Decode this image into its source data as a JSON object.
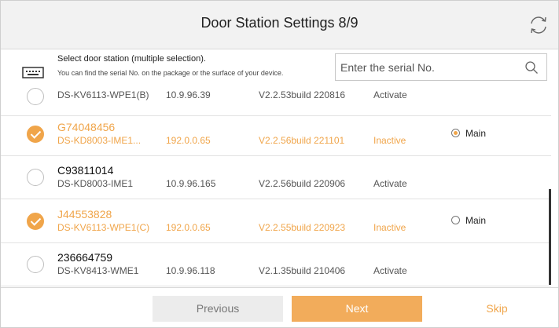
{
  "header": {
    "title": "Door Station Settings 8/9"
  },
  "hint": {
    "title": "Select door station (multiple selection).",
    "description": "You can find the serial No. on the package or the surface of your device."
  },
  "search": {
    "placeholder": "Enter the serial No.",
    "value": ""
  },
  "rows": [
    {
      "serial": "",
      "model": "DS-KV6113-WPE1(B)",
      "ip": "10.9.96.39",
      "version": "V2.2.53build 220816",
      "status": "Activate",
      "selected": false,
      "main": null
    },
    {
      "serial": "G74048456",
      "model": "DS-KD8003-IME1...",
      "ip": "192.0.0.65",
      "version": "V2.2.56build 221101",
      "status": "Inactive",
      "selected": true,
      "main": "Main"
    },
    {
      "serial": "C93811014",
      "model": "DS-KD8003-IME1",
      "ip": "10.9.96.165",
      "version": "V2.2.56build 220906",
      "status": "Activate",
      "selected": false,
      "main": null
    },
    {
      "serial": "J44553828",
      "model": "DS-KV6113-WPE1(C)",
      "ip": "192.0.0.65",
      "version": "V2.2.55build 220923",
      "status": "Inactive",
      "selected": true,
      "main": "Main"
    },
    {
      "serial": "236664759",
      "model": "DS-KV8413-WME1",
      "ip": "10.9.96.118",
      "version": "V2.1.35build 210406",
      "status": "Activate",
      "selected": false,
      "main": null
    }
  ],
  "footer": {
    "previous": "Previous",
    "next": "Next",
    "skip": "Skip"
  },
  "colors": {
    "accent": "#f0a54a",
    "next_button": "#f2ac5b",
    "disabled_button": "#ececec"
  },
  "icons": {
    "refresh": "refresh-icon",
    "device": "device-icon",
    "search": "search-icon"
  }
}
